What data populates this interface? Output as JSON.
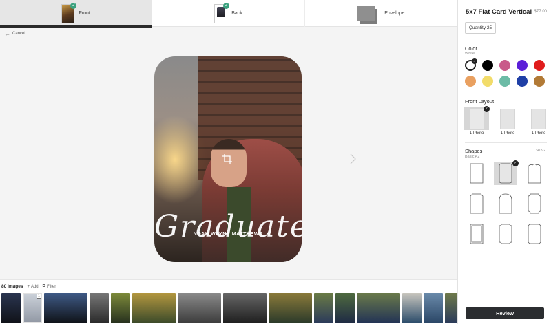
{
  "tabs": [
    {
      "label": "Front",
      "active": true,
      "checked": true
    },
    {
      "label": "Back",
      "active": false,
      "checked": true
    },
    {
      "label": "Envelope",
      "active": false,
      "checked": false
    }
  ],
  "cancel_label": "Cancel",
  "card": {
    "script_text": "Graduate",
    "name_text": "NOAH WAYNE MATTHEWS"
  },
  "filmstrip": {
    "count_label": "80 Images",
    "add_label": "Add",
    "filter_label": "Filter",
    "badge": "1",
    "photos": [
      {
        "colors": [
          "#2a3550",
          "#101218"
        ]
      },
      {
        "colors": [
          "#bcc4cf",
          "#6c7585"
        ],
        "faded": true
      },
      {
        "colors": [
          "#3f5a86",
          "#0f1217"
        ]
      },
      {
        "colors": [
          "#777777",
          "#2a2a2a"
        ]
      },
      {
        "colors": [
          "#7d8a3a",
          "#26301e"
        ]
      },
      {
        "colors": [
          "#b3973f",
          "#3b4a2a"
        ]
      },
      {
        "colors": [
          "#8a8a8a",
          "#3c3c3c"
        ]
      },
      {
        "colors": [
          "#666666",
          "#1f1f1f"
        ]
      },
      {
        "colors": [
          "#8a7a3a",
          "#2b3a2a"
        ]
      },
      {
        "colors": [
          "#6a7b45",
          "#2b3a5a"
        ]
      },
      {
        "colors": [
          "#4f6a3f",
          "#1e2a44"
        ]
      },
      {
        "colors": [
          "#6a7a4a",
          "#223355"
        ]
      },
      {
        "colors": [
          "#c9c6be",
          "#2a4b6a"
        ]
      },
      {
        "colors": [
          "#6a8aaa",
          "#2a4666"
        ]
      },
      {
        "colors": [
          "#6f7a4a",
          "#2a3a5a"
        ]
      }
    ]
  },
  "panel": {
    "product_title": "5x7 Flat Card Vertical",
    "price": "$77.00",
    "quantity_label": "Quantity 25",
    "color": {
      "title": "Color",
      "selected_name": "White",
      "swatches": [
        "#ffffff",
        "#000000",
        "#c95a8a",
        "#5b1fd8",
        "#e01c1c",
        "#e9a060",
        "#f2dc6a",
        "#6cbba6",
        "#1f3fa6",
        "#b27a36"
      ]
    },
    "front_layout": {
      "title": "Front Layout",
      "options": [
        {
          "label": "1 Photo",
          "selected": true
        },
        {
          "label": "1 Photo",
          "selected": false
        },
        {
          "label": "1 Photo",
          "selected": false
        }
      ]
    },
    "shapes": {
      "title": "Shapes",
      "subtitle": "Basic A2",
      "price": "$0.92",
      "items": [
        "rect",
        "rounded",
        "scallop",
        "notch",
        "arch",
        "ticket",
        "stamp",
        "bracket",
        "cut"
      ],
      "selected_index": 1
    },
    "review_label": "Review"
  }
}
